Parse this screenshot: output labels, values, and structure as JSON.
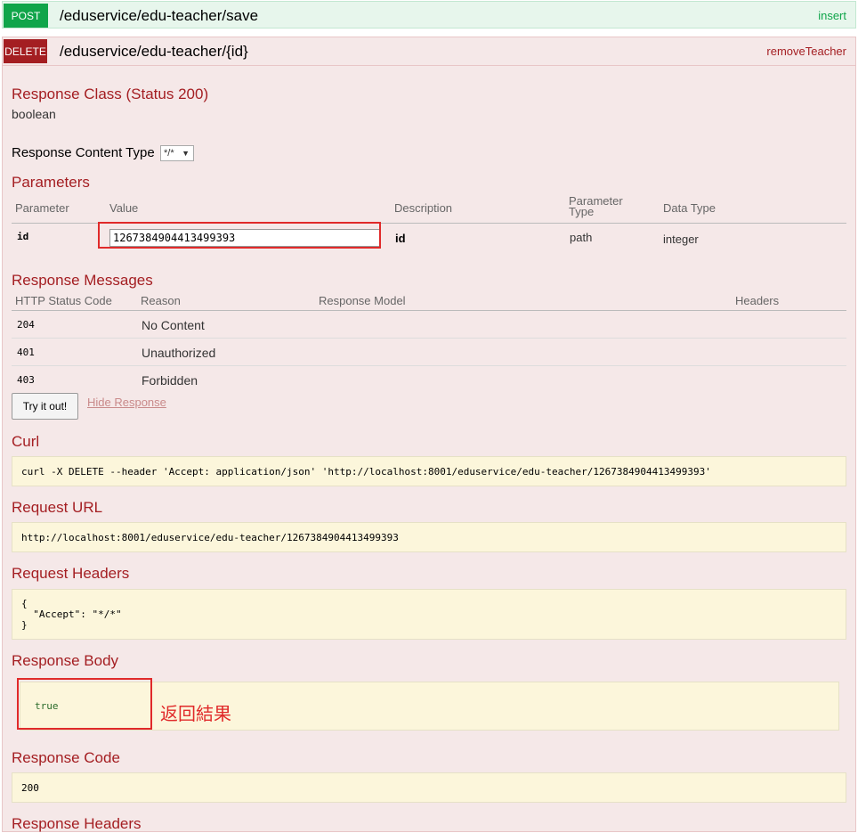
{
  "post_op": {
    "verb": "POST",
    "path": "/eduservice/edu-teacher/save",
    "nickname": "insert",
    "color": "#10a54a"
  },
  "delete_op": {
    "verb": "DELETE",
    "path": "/eduservice/edu-teacher/{id}",
    "nickname": "removeTeacher",
    "color": "#a41e22",
    "response_class_title": "Response Class (Status 200)",
    "response_class_type": "boolean",
    "response_content_type_label": "Response Content Type",
    "response_content_type_value": "*/*",
    "parameters_title": "Parameters",
    "param_headers": {
      "parameter": "Parameter",
      "value": "Value",
      "description": "Description",
      "param_type_1": "Parameter",
      "param_type_2": "Type",
      "data_type": "Data Type"
    },
    "param_row": {
      "name": "id",
      "value": "1267384904413499393",
      "description": "id",
      "param_type": "path",
      "data_type": "integer"
    },
    "response_messages_title": "Response Messages",
    "msg_headers": {
      "status": "HTTP Status Code",
      "reason": "Reason",
      "model": "Response Model",
      "headers": "Headers"
    },
    "messages": [
      {
        "code": "204",
        "reason": "No Content"
      },
      {
        "code": "401",
        "reason": "Unauthorized"
      },
      {
        "code": "403",
        "reason": "Forbidden"
      }
    ],
    "try_button": "Try it out!",
    "hide_response": "Hide Response",
    "curl_title": "Curl",
    "curl_cmd": "curl -X DELETE --header 'Accept: application/json' 'http://localhost:8001/eduservice/edu-teacher/1267384904413499393'",
    "request_url_title": "Request URL",
    "request_url": "http://localhost:8001/eduservice/edu-teacher/1267384904413499393",
    "request_headers_title": "Request Headers",
    "request_headers_lines": [
      "{",
      "  \"Accept\": \"*/*\"",
      "}"
    ],
    "response_body_title": "Response Body",
    "response_body": "true",
    "response_body_annotation": "返回結果",
    "response_code_title": "Response Code",
    "response_code": "200",
    "response_headers_title": "Response Headers"
  }
}
